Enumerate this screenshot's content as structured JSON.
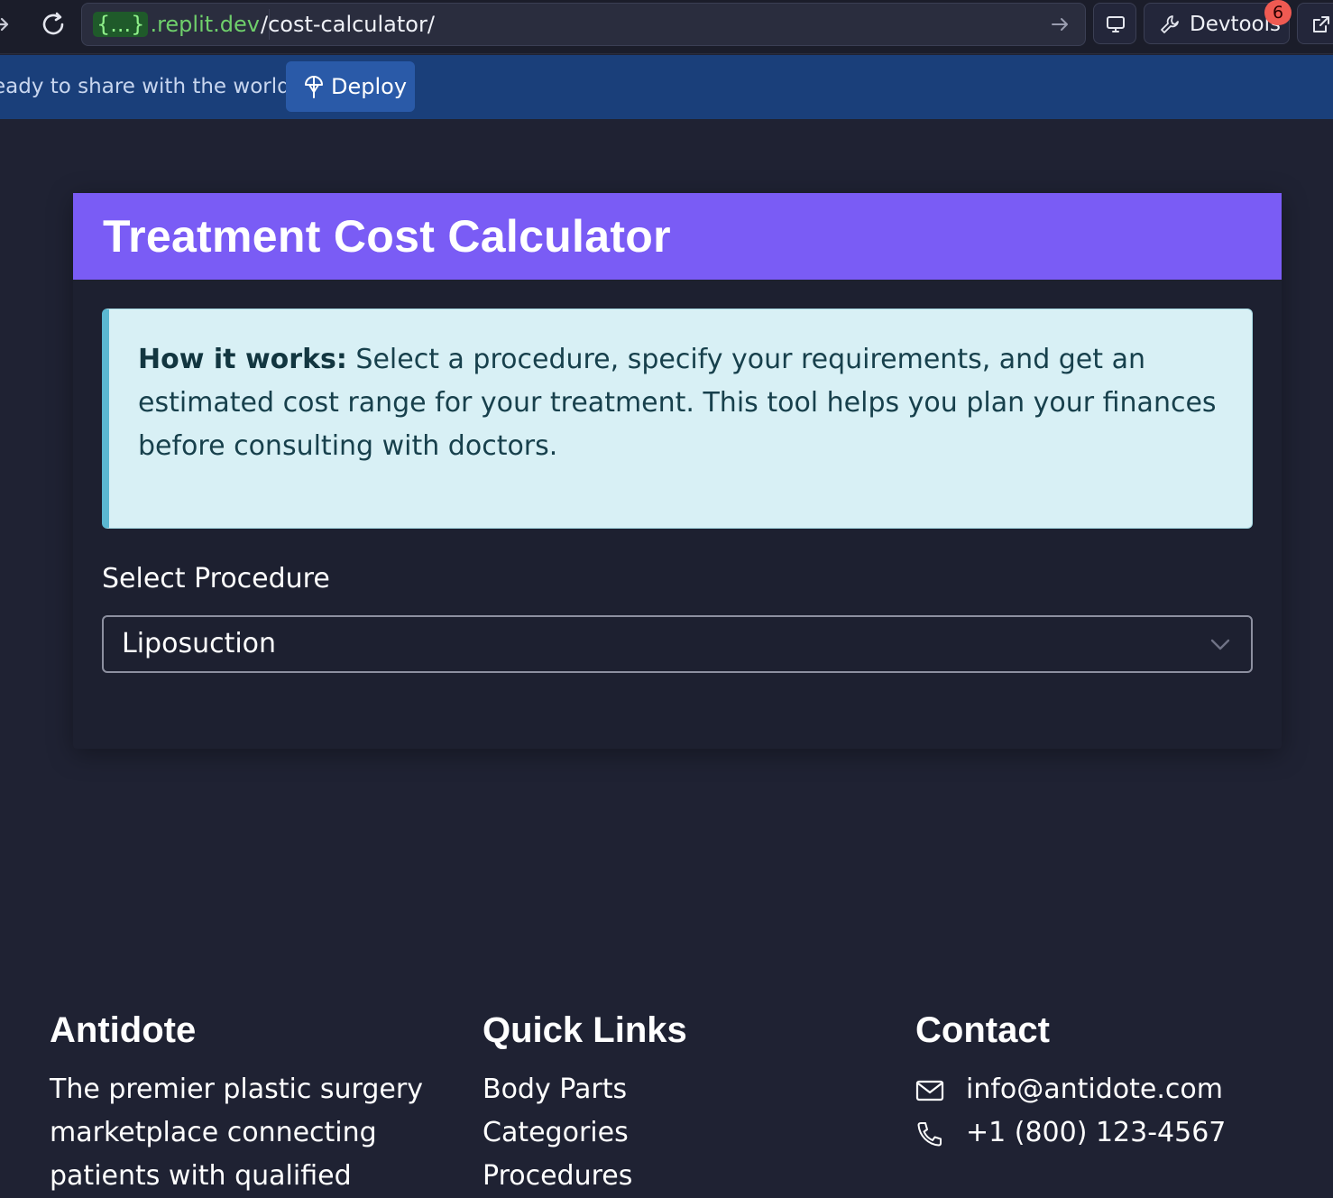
{
  "browser": {
    "url_host_brace": "{...}",
    "url_host_domain": ".replit.dev",
    "url_path": "/cost-calculator/",
    "devtools_label": "Devtools",
    "devtools_badge": "6"
  },
  "deploy_bar": {
    "message": "eady to share with the world?",
    "deploy_label": "Deploy"
  },
  "card": {
    "title": "Treatment Cost Calculator",
    "info_bold": "How it works:",
    "info_text": " Select a procedure, specify your requirements, and get an estimated cost range for your treatment. This tool helps you plan your finances before consulting with doctors.",
    "select_label": "Select Procedure",
    "select_value": "Liposuction"
  },
  "footer": {
    "brand": {
      "heading": "Antidote",
      "tagline": "The premier plastic surgery marketplace connecting patients with qualified"
    },
    "quick_links": {
      "heading": "Quick Links",
      "items": [
        "Body Parts",
        "Categories",
        "Procedures"
      ]
    },
    "contact": {
      "heading": "Contact",
      "email": "info@antidote.com",
      "phone": "+1 (800) 123-4567"
    }
  },
  "colors": {
    "page_bg": "#1f2233",
    "header_purple": "#7a5cf5",
    "deploy_bar": "#1a3f7a",
    "info_bg": "#d8f0f5",
    "info_accent": "#5bb8d2"
  }
}
